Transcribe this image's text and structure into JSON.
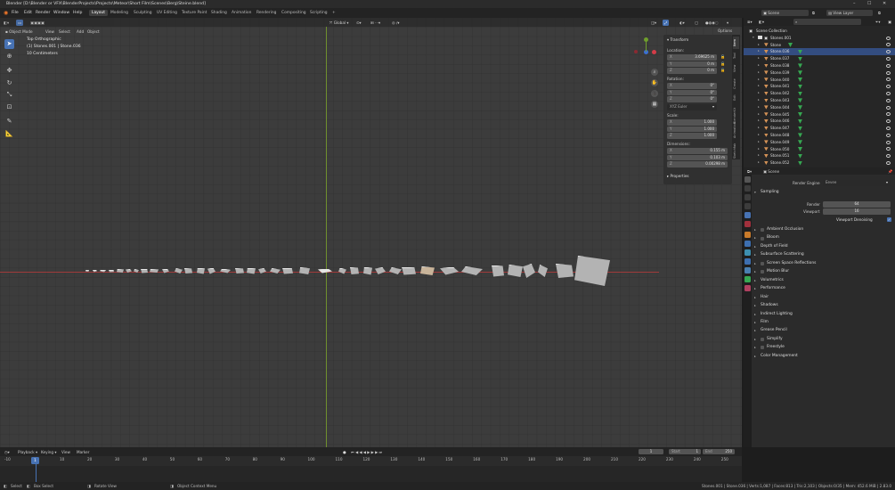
{
  "window": {
    "title": "Blender [D:\\Blender or VFX\\BlenderProjects\\Projects\\Meteor\\Short Film\\Scenes\\Berg\\Steine.blend]"
  },
  "menus": [
    "File",
    "Edit",
    "Render",
    "Window",
    "Help"
  ],
  "workspaces": [
    "Layout",
    "Modeling",
    "Sculpting",
    "UV Editing",
    "Texture Paint",
    "Shading",
    "Animation",
    "Rendering",
    "Compositing",
    "Scripting"
  ],
  "workspace_add": "+",
  "scene_name": "Scene",
  "view_layer": "View Layer",
  "viewport": {
    "mode": "Object Mode",
    "menus": [
      "View",
      "Select",
      "Add",
      "Object"
    ],
    "transform_orientation": "Global",
    "overlay_text": {
      "view": "Top Orthographic",
      "collection": "(1) Stones.001 | Stone.036",
      "scale": "10 Centimeters"
    },
    "options": "Options"
  },
  "npanel": {
    "transform_header": "Transform",
    "location_label": "Location:",
    "location": [
      {
        "k": "X",
        "v": "3.69625 m"
      },
      {
        "k": "Y",
        "v": "0 m"
      },
      {
        "k": "Z",
        "v": "0 m"
      }
    ],
    "rotation_label": "Rotation:",
    "rotation": [
      {
        "k": "X",
        "v": "0°"
      },
      {
        "k": "Y",
        "v": "0°"
      },
      {
        "k": "Z",
        "v": "0°"
      }
    ],
    "rotation_mode": "XYZ Euler",
    "scale_label": "Scale:",
    "scale": [
      {
        "k": "X",
        "v": "1.000"
      },
      {
        "k": "Y",
        "v": "1.000"
      },
      {
        "k": "Z",
        "v": "1.000"
      }
    ],
    "dimensions_label": "Dimensions:",
    "dimensions": [
      {
        "k": "X",
        "v": "0.155 m"
      },
      {
        "k": "Y",
        "v": "0.103 m"
      },
      {
        "k": "Z",
        "v": "0.00298 m"
      }
    ],
    "properties_header": "Properties",
    "side_tabs": [
      "Item",
      "Tool",
      "View",
      "Create",
      "Edit",
      "BlenderKit",
      "Animation",
      "Sketchfab"
    ]
  },
  "outliner": {
    "root": "Scene Collection",
    "collection": "Stones.001",
    "items": [
      "Stone",
      "Stone.036",
      "Stone.037",
      "Stone.038",
      "Stone.039",
      "Stone.040",
      "Stone.041",
      "Stone.042",
      "Stone.043",
      "Stone.044",
      "Stone.045",
      "Stone.046",
      "Stone.047",
      "Stone.048",
      "Stone.049",
      "Stone.050",
      "Stone.051",
      "Stone.052"
    ],
    "selected": "Stone.036"
  },
  "properties": {
    "scene_label": "Scene",
    "render_engine_label": "Render Engine",
    "render_engine": "Eevee",
    "sampling": "Sampling",
    "render_label": "Render",
    "render_samples": "64",
    "viewport_label": "Viewport",
    "viewport_samples": "16",
    "viewport_denoising": "Viewport Denoising",
    "sections": [
      {
        "label": "Ambient Occlusion",
        "check": true
      },
      {
        "label": "Bloom",
        "check": true
      },
      {
        "label": "Depth of Field",
        "check": false
      },
      {
        "label": "Subsurface Scattering",
        "check": false
      },
      {
        "label": "Screen Space Reflections",
        "check": true
      },
      {
        "label": "Motion Blur",
        "check": true
      },
      {
        "label": "Volumetrics",
        "check": false
      },
      {
        "label": "Performance",
        "check": false
      },
      {
        "label": "Hair",
        "check": false
      },
      {
        "label": "Shadows",
        "check": false
      },
      {
        "label": "Indirect Lighting",
        "check": false
      },
      {
        "label": "Film",
        "check": false
      },
      {
        "label": "Grease Pencil",
        "check": false
      },
      {
        "label": "Simplify",
        "check": true
      },
      {
        "label": "Freestyle",
        "check": true
      },
      {
        "label": "Color Management",
        "check": false
      }
    ]
  },
  "timeline": {
    "menus": [
      "Playback",
      "Keying",
      "View",
      "Marker"
    ],
    "current_frame": "1",
    "start_label": "Start",
    "start": "1",
    "end_label": "End",
    "end": "250",
    "ruler_ticks": [
      "-10",
      "10",
      "20",
      "30",
      "40",
      "50",
      "60",
      "70",
      "80",
      "90",
      "100",
      "110",
      "120",
      "130",
      "140",
      "150",
      "160",
      "170",
      "180",
      "190",
      "200",
      "210",
      "220",
      "230",
      "240",
      "250"
    ],
    "playhead": "1"
  },
  "statusbar": {
    "select": "Select",
    "box_select": "Box Select",
    "rotate_view": "Rotate View",
    "context_menu": "Object Context Menu",
    "stats": "Stones.001 | Stone.036 | Verts:1,087 | Faces:813 | Tris:2,103 | Objects:0/35 | Mem: 452.6 MiB | 2.83.0"
  },
  "colors": {
    "accent": "#4772b3",
    "x_axis": "#a13a3a",
    "y_axis": "#6f8f2e",
    "selected_row": "#334d80"
  }
}
